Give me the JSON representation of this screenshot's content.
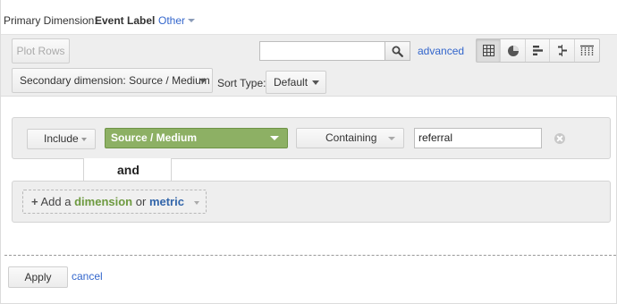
{
  "primary_dimension": {
    "label": "Primary Dimension:",
    "active": "Event Label",
    "other": "Other"
  },
  "toolbar": {
    "plot_rows": "Plot Rows",
    "search_placeholder": "",
    "advanced": "advanced",
    "view_icons": [
      "table-view-icon",
      "pie-view-icon",
      "bar-view-icon",
      "comparison-view-icon",
      "pivot-view-icon"
    ],
    "active_view": "table",
    "secondary_dimension": "Secondary dimension: Source / Medium",
    "sort_type_label": "Sort Type:",
    "sort_type_value": "Default"
  },
  "filter": {
    "include": "Include",
    "dimension": "Source / Medium",
    "match_type": "Containing",
    "value": "referral",
    "and_label": "and",
    "add_prefix": "+",
    "add_text_1": "Add a",
    "add_dimension": "dimension",
    "add_or": "or",
    "add_metric": "metric"
  },
  "footer": {
    "apply": "Apply",
    "cancel": "cancel"
  },
  "colors": {
    "link": "#3366cc",
    "dimension_green": "#8db064",
    "metric_blue": "#3366aa"
  }
}
